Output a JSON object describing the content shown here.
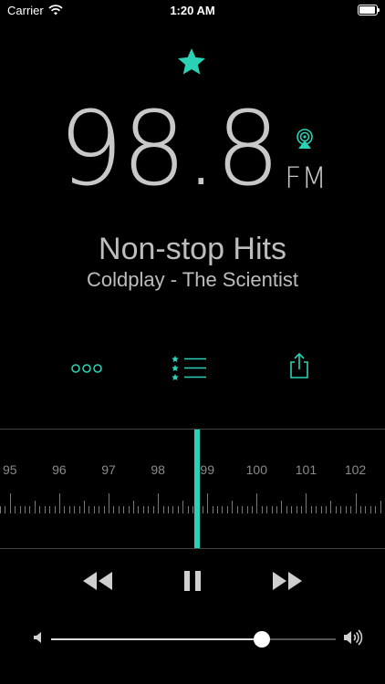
{
  "status": {
    "carrier": "Carrier",
    "time": "1:20 AM"
  },
  "now_playing": {
    "freq_int": "98",
    "freq_dot": ".",
    "freq_dec": "8",
    "band": "FM",
    "station": "Non-stop Hits",
    "track": "Coldplay - The Scientist",
    "favorite": true
  },
  "actions": [
    {
      "name": "more",
      "icon": "ellipsis-icon"
    },
    {
      "name": "favorites-list",
      "icon": "star-list-icon"
    },
    {
      "name": "share",
      "icon": "share-icon"
    }
  ],
  "tuner": {
    "labels": [
      "95",
      "96",
      "97",
      "98",
      "99",
      "100",
      "101",
      "102"
    ],
    "value": 98.8,
    "min": 94.8,
    "max": 102.6
  },
  "playback": {
    "state": "playing",
    "volume": 0.74
  },
  "colors": {
    "accent": "#2bd1b4",
    "background": "#000000",
    "text": "#c8c8c8"
  }
}
